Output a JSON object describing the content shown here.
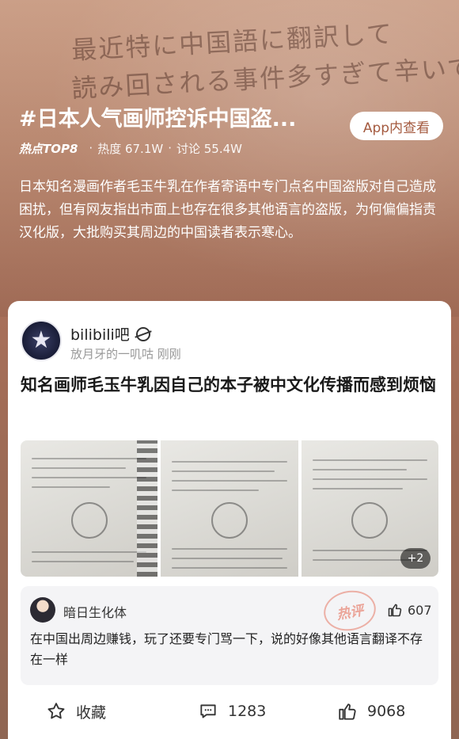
{
  "hero": {
    "handwriting_line1": "最近特に中国語に翻訳して",
    "handwriting_line2": "読み回される事件多すぎて辛いです。",
    "title": "#日本人气画师控诉中国盗...",
    "app_button": "App内查看",
    "hot_logo_text": "热点TOP8",
    "heat": "热度 67.1W",
    "discussion": "讨论 55.4W",
    "description": "日本知名漫画作者毛玉牛乳在作者寄语中专门点名中国盗版对自己造成困扰，但有网友指出市面上也存在很多其他语言的盗版，为何偏偏指责汉化版，大批购买其周边的中国读者表示寒心。"
  },
  "post": {
    "source_name": "bilibili吧",
    "author": "放月牙的一叽咕",
    "time": "刚刚",
    "title": "知名画师毛玉牛乳因自己的本子被中文化传播而感到烦恼",
    "more_images": "+2"
  },
  "comment": {
    "user": "暗日生化体",
    "stamp": "热评",
    "likes": "607",
    "text": "在中国出周边赚钱，玩了还要专门骂一下，说的好像其他语言翻译不存在一样"
  },
  "actions": {
    "favorite": "收藏",
    "comments": "1283",
    "likes": "9068"
  },
  "colors": {
    "hero_background": "#b07a62",
    "button_text": "#a45a3f",
    "stamp": "#e56e5a"
  }
}
